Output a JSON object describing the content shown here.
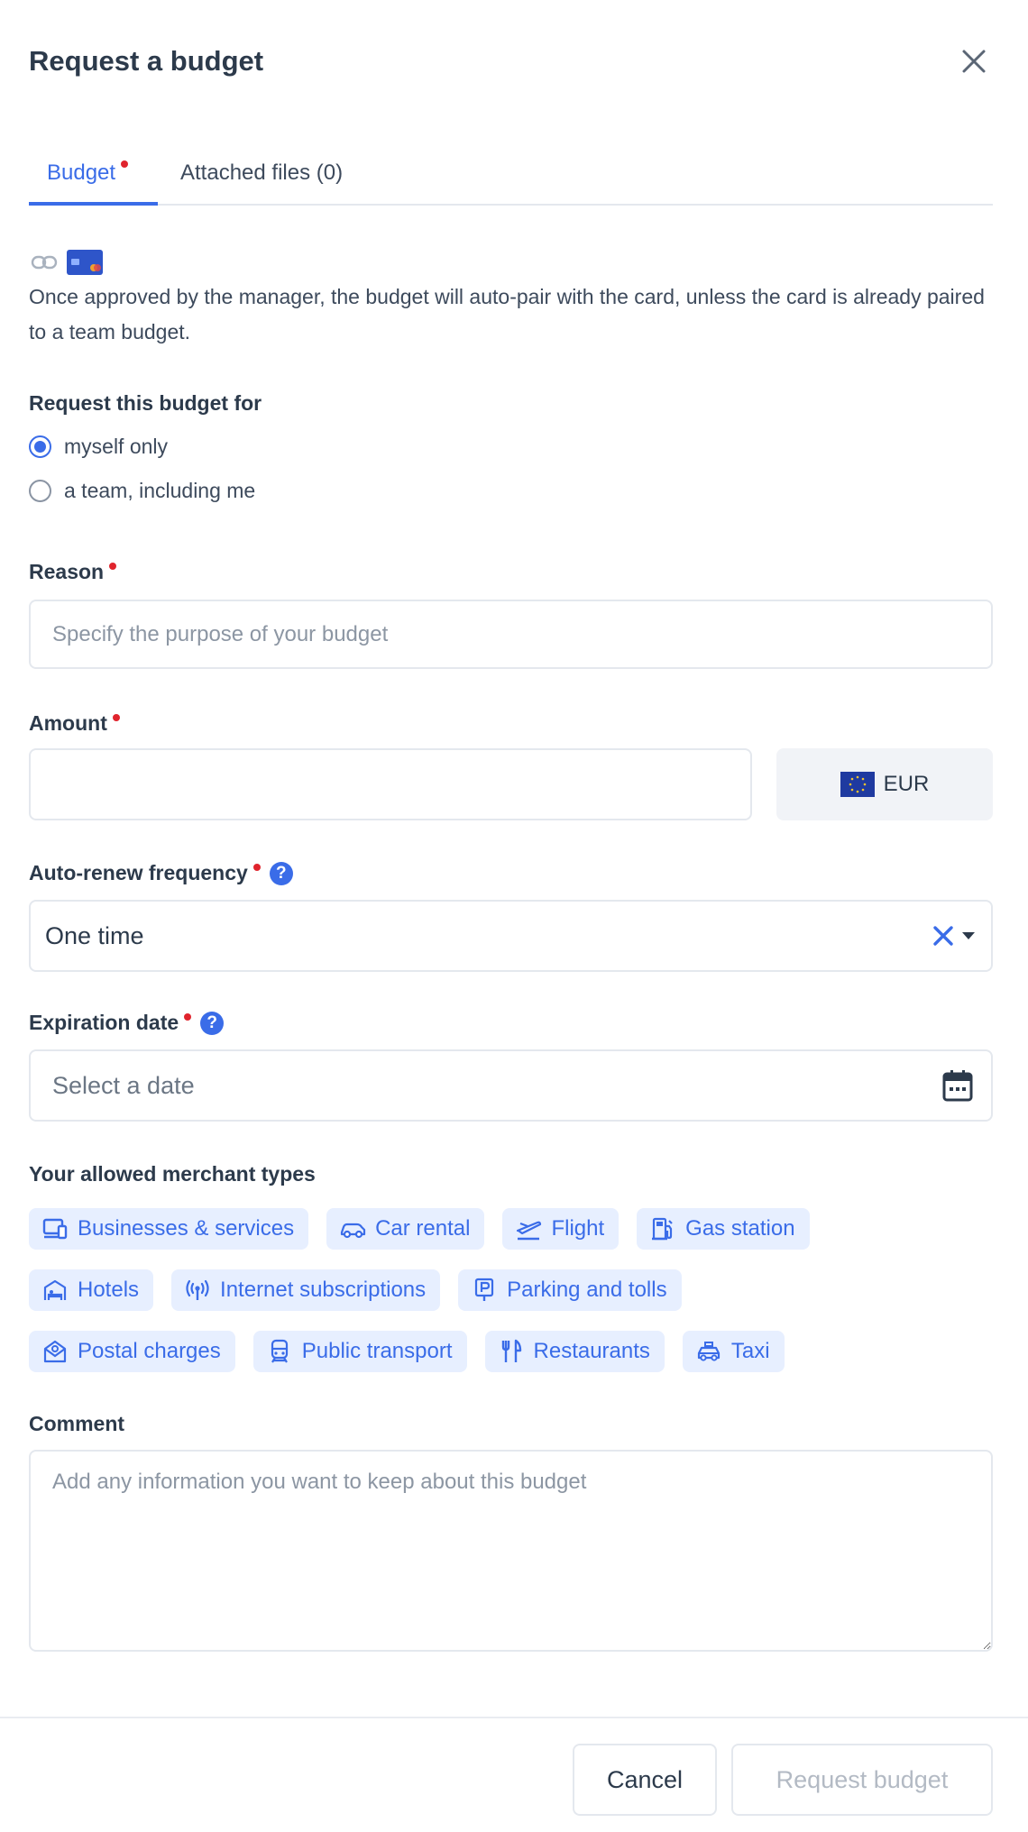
{
  "dialog": {
    "title": "Request a budget",
    "close_icon": "close-icon"
  },
  "tabs": [
    {
      "label": "Budget",
      "required": true,
      "active": true
    },
    {
      "label": "Attached files (0)",
      "required": false,
      "active": false
    }
  ],
  "info": {
    "icons": [
      "link-icon",
      "card-icon"
    ],
    "text": "Once approved by the manager, the budget will auto-pair with the card, unless the card is already paired to a team budget."
  },
  "request_for": {
    "label": "Request this budget for",
    "options": [
      {
        "label": "myself only",
        "selected": true
      },
      {
        "label": "a team, including me",
        "selected": false
      }
    ]
  },
  "reason": {
    "label": "Reason",
    "value": "",
    "placeholder": "Specify the purpose of your budget"
  },
  "amount": {
    "label": "Amount",
    "value": "",
    "currency": "EUR",
    "currency_icon": "eu-flag-icon"
  },
  "frequency": {
    "label": "Auto-renew frequency",
    "value": "One time",
    "help_icon": "help-icon",
    "help_glyph": "?"
  },
  "expiration": {
    "label": "Expiration date",
    "placeholder": "Select a date",
    "help_glyph": "?",
    "icon": "calendar-icon"
  },
  "merchants": {
    "label": "Your allowed merchant types",
    "rows": [
      [
        {
          "label": "Businesses & services",
          "icon": "businesses-icon"
        },
        {
          "label": "Car rental",
          "icon": "car-icon"
        },
        {
          "label": "Flight",
          "icon": "plane-icon"
        },
        {
          "label": "Gas station",
          "icon": "gas-station-icon"
        }
      ],
      [
        {
          "label": "Hotels",
          "icon": "hotel-icon"
        },
        {
          "label": "Internet subscriptions",
          "icon": "broadcast-icon"
        },
        {
          "label": "Parking and tolls",
          "icon": "parking-icon"
        }
      ],
      [
        {
          "label": "Postal charges",
          "icon": "mail-icon"
        },
        {
          "label": "Public transport",
          "icon": "train-icon"
        },
        {
          "label": "Restaurants",
          "icon": "fork-knife-icon"
        },
        {
          "label": "Taxi",
          "icon": "taxi-icon"
        }
      ]
    ]
  },
  "comment": {
    "label": "Comment",
    "value": "",
    "placeholder": "Add any information you want to keep about this budget"
  },
  "footer": {
    "cancel_label": "Cancel",
    "submit_label": "Request budget"
  },
  "colors": {
    "accent": "#3a6ce8",
    "required": "#e0242d",
    "chip_bg": "#e7efff",
    "text": "#2c3a4b",
    "disabled_text": "#b3bac4"
  }
}
